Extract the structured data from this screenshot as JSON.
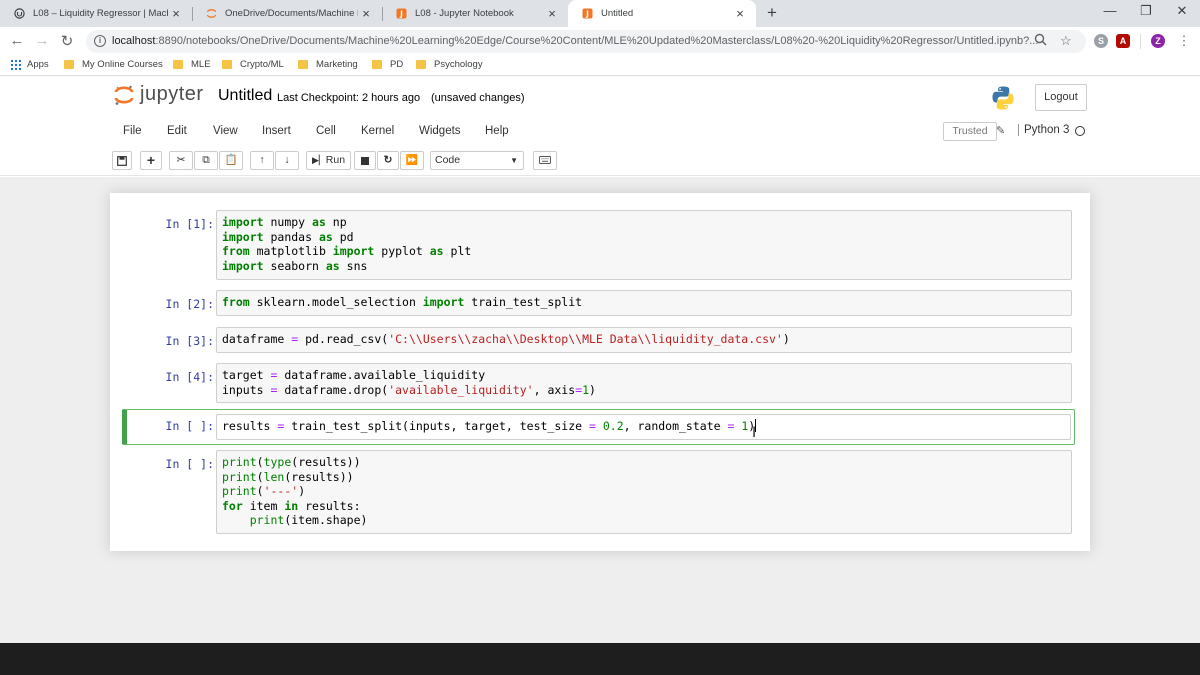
{
  "browser": {
    "tabs": [
      {
        "title": "L08 – Liquidity Regressor | Mach",
        "icon": "udemy-icon",
        "active": false
      },
      {
        "title": "OneDrive/Documents/Machine L",
        "icon": "jupyter-tab-icon",
        "active": false
      },
      {
        "title": "L08 - Jupyter Notebook",
        "icon": "jupyter-tab-icon",
        "active": false
      },
      {
        "title": "Untitled",
        "icon": "jupyter-tab-icon",
        "active": true
      }
    ],
    "new_tab": "+",
    "close_glyph": "×",
    "window_controls": {
      "minimize": "—",
      "restore": "❐",
      "close": "✕"
    },
    "url_host": "localhost",
    "url_path": ":8890/notebooks/OneDrive/Documents/Machine%20Learning%20Edge/Course%20Content/MLE%20Updated%20Masterclass/L08%20-%20Liquidity%20Regressor/Untitled.ipynb?...",
    "profile_initial": "Z",
    "bookmarks": [
      {
        "label": "Apps",
        "icon": "apps-grid-icon"
      },
      {
        "label": "My Online Courses",
        "icon": "folder-icon"
      },
      {
        "label": "MLE",
        "icon": "folder-icon"
      },
      {
        "label": "Crypto/ML",
        "icon": "folder-icon"
      },
      {
        "label": "Marketing",
        "icon": "folder-icon"
      },
      {
        "label": "PD",
        "icon": "folder-icon"
      },
      {
        "label": "Psychology",
        "icon": "folder-icon"
      }
    ]
  },
  "jupyter": {
    "logo_text": "jupyter",
    "notebook_name": "Untitled",
    "checkpoint": "Last Checkpoint: 2 hours ago",
    "autosave": "(unsaved changes)",
    "logout": "Logout",
    "menus": [
      "File",
      "Edit",
      "View",
      "Insert",
      "Cell",
      "Kernel",
      "Widgets",
      "Help"
    ],
    "trusted": "Trusted",
    "kernel": "Python 3",
    "toolbar": {
      "run": "Run",
      "cell_type": "Code"
    },
    "accent_color": "#42a047"
  },
  "cells": [
    {
      "prompt": "In [1]:",
      "lines": [
        [
          [
            "kw",
            "import"
          ],
          [
            "",
            " numpy "
          ],
          [
            "kw",
            "as"
          ],
          [
            "",
            " np"
          ]
        ],
        [
          [
            "kw",
            "import"
          ],
          [
            "",
            " pandas "
          ],
          [
            "kw",
            "as"
          ],
          [
            "",
            " pd"
          ]
        ],
        [
          [
            "kw",
            "from"
          ],
          [
            "",
            " matplotlib "
          ],
          [
            "kw",
            "import"
          ],
          [
            "",
            " pyplot "
          ],
          [
            "kw",
            "as"
          ],
          [
            "",
            " plt"
          ]
        ],
        [
          [
            "kw",
            "import"
          ],
          [
            "",
            " seaborn "
          ],
          [
            "kw",
            "as"
          ],
          [
            "",
            " sns"
          ]
        ]
      ]
    },
    {
      "prompt": "In [2]:",
      "lines": [
        [
          [
            "kw",
            "from"
          ],
          [
            "",
            " sklearn.model_selection "
          ],
          [
            "kw",
            "import"
          ],
          [
            "",
            " train_test_split"
          ]
        ]
      ]
    },
    {
      "prompt": "In [3]:",
      "lines": [
        [
          [
            "",
            "dataframe "
          ],
          [
            "op",
            "="
          ],
          [
            "",
            " pd.read_csv("
          ],
          [
            "st",
            "'C:\\\\Users\\\\zacha\\\\Desktop\\\\MLE Data\\\\liquidity_data.csv'"
          ],
          [
            "",
            ")"
          ]
        ]
      ]
    },
    {
      "prompt": "In [4]:",
      "lines": [
        [
          [
            "",
            "target "
          ],
          [
            "op",
            "="
          ],
          [
            "",
            " dataframe.available_liquidity"
          ]
        ],
        [
          [
            "",
            "inputs "
          ],
          [
            "op",
            "="
          ],
          [
            "",
            " dataframe.drop("
          ],
          [
            "st",
            "'available_liquidity'"
          ],
          [
            "",
            ", axis"
          ],
          [
            "op",
            "="
          ],
          [
            "nm",
            "1"
          ],
          [
            "",
            ")"
          ]
        ]
      ]
    },
    {
      "prompt": "In [ ]:",
      "selected": true,
      "lines": [
        [
          [
            "",
            "results "
          ],
          [
            "op",
            "="
          ],
          [
            "",
            " train_test_split(inputs, target, test_size "
          ],
          [
            "op",
            "="
          ],
          [
            "",
            " "
          ],
          [
            "nm",
            "0.2"
          ],
          [
            "",
            ", random_state "
          ],
          [
            "op",
            "="
          ],
          [
            "",
            " "
          ],
          [
            "nm",
            "1"
          ],
          [
            "",
            ")"
          ]
        ]
      ]
    },
    {
      "prompt": "In [ ]:",
      "lines": [
        [
          [
            "bi",
            "print"
          ],
          [
            "",
            "("
          ],
          [
            "bi",
            "type"
          ],
          [
            "",
            "(results))"
          ]
        ],
        [
          [
            "bi",
            "print"
          ],
          [
            "",
            "("
          ],
          [
            "bi",
            "len"
          ],
          [
            "",
            "(results))"
          ]
        ],
        [
          [
            "bi",
            "print"
          ],
          [
            "",
            "("
          ],
          [
            "st",
            "'---'"
          ],
          [
            "",
            ")"
          ]
        ],
        [
          [
            "kw",
            "for"
          ],
          [
            "",
            " item "
          ],
          [
            "kw",
            "in"
          ],
          [
            "",
            " results:"
          ]
        ],
        [
          [
            "",
            "    "
          ],
          [
            "bi",
            "print"
          ],
          [
            "",
            "(item.shape)"
          ]
        ]
      ]
    }
  ]
}
